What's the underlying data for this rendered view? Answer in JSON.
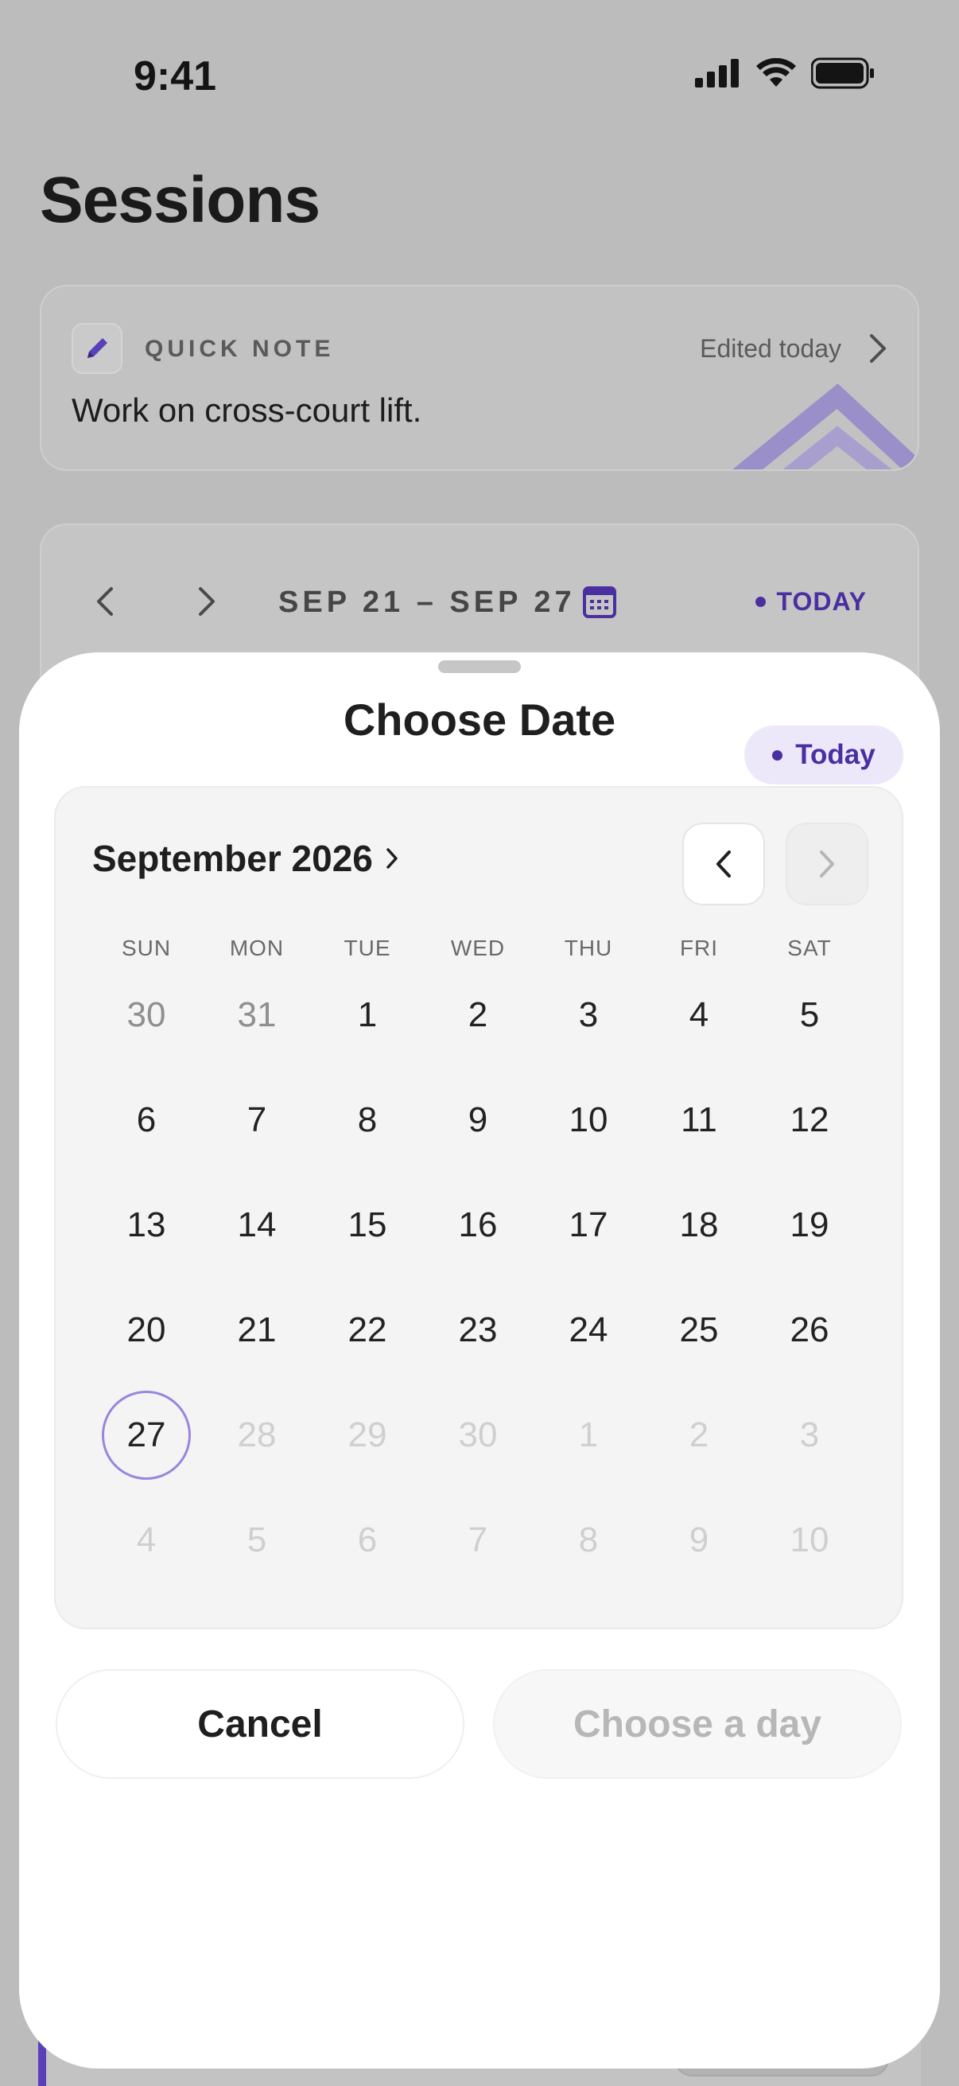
{
  "status_bar": {
    "time": "9:41"
  },
  "page": {
    "title": "Sessions"
  },
  "quick_note": {
    "label": "QUICK NOTE",
    "edited": "Edited today",
    "text": "Work on cross-court lift."
  },
  "week": {
    "range": "SEP 21 – SEP 27",
    "today_label": "TODAY"
  },
  "sheet": {
    "title": "Choose Date",
    "today_pill": "Today",
    "month_label": "September 2026",
    "weekdays": [
      "SUN",
      "MON",
      "TUE",
      "WED",
      "THU",
      "FRI",
      "SAT"
    ],
    "weeks": [
      [
        "30",
        "31",
        "1",
        "2",
        "3",
        "4",
        "5"
      ],
      [
        "6",
        "7",
        "8",
        "9",
        "10",
        "11",
        "12"
      ],
      [
        "13",
        "14",
        "15",
        "16",
        "17",
        "18",
        "19"
      ],
      [
        "20",
        "21",
        "22",
        "23",
        "24",
        "25",
        "26"
      ],
      [
        "27",
        "28",
        "29",
        "30",
        "1",
        "2",
        "3"
      ],
      [
        "4",
        "5",
        "6",
        "7",
        "8",
        "9",
        "10"
      ]
    ],
    "cancel_label": "Cancel",
    "choose_label": "Choose a day"
  },
  "colors": {
    "accent": "#4a2fa0",
    "today_ring": "#9a86dd",
    "pill_bg": "#ece8f9"
  },
  "icons": {
    "note": "pencil-icon",
    "calendar": "calendar-icon",
    "signal": "signal-icon",
    "wifi": "wifi-icon",
    "battery": "battery-icon"
  }
}
